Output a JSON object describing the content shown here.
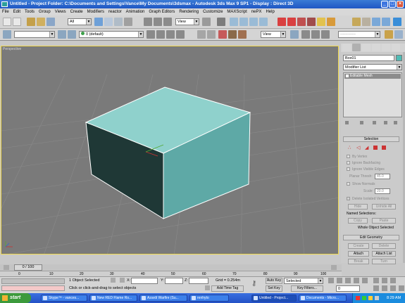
{
  "window": {
    "title": "Untitled    - Project Folder: C:\\Documents and Settings\\Vance\\My Documents\\3dsmax    - Autodesk 3ds Max 9 SP1    - Display : Direct 3D"
  },
  "menu": [
    "File",
    "Edit",
    "Tools",
    "Group",
    "Views",
    "Create",
    "Modifiers",
    "reactor",
    "Animation",
    "Graph Editors",
    "Rendering",
    "Customize",
    "MAXScript",
    "nePX",
    "Help"
  ],
  "toolbar": {
    "selection_filter": "All",
    "view_dropdown": "View",
    "layer_dropdown": "0 (default)",
    "view_dropdown2": "View"
  },
  "viewport": {
    "label": "Perspective",
    "box_colors": {
      "top": "#8fd1cc",
      "front": "#5ea9a6",
      "left": "#1f3836"
    }
  },
  "command_panel": {
    "object_name": "Box01",
    "modifier_list": "Modifier List",
    "stack_item": "Editable Mesh",
    "selection_rollout": "Selection",
    "by_vertex": "By Vertex",
    "ignore_backfacing": "Ignore Backfacing",
    "ignore_visible_edges": "Ignore Visible Edges",
    "planar_thresh_label": "Planar Thresh:",
    "planar_thresh_value": "45.0",
    "show_normals": "Show Normals",
    "scale_label": "Scale:",
    "scale_value": "20.0",
    "delete_isolated": "Delete Isolated Vertices",
    "hide": "Hide",
    "unhide_all": "Unhide All",
    "named_selections": "Named Selections:",
    "copy": "Copy",
    "paste": "Paste",
    "whole_object": "Whole Object Selected",
    "edit_geometry_rollout": "Edit Geometry",
    "create": "Create",
    "delete": "Delete",
    "attach": "Attach",
    "attach_list": "Attach List",
    "break": "Break",
    "turn": "Turn"
  },
  "timeline": {
    "frame_counter": "0 / 100",
    "ticks": [
      "0",
      "10",
      "20",
      "30",
      "40",
      "50",
      "60",
      "70",
      "80",
      "90",
      "100"
    ]
  },
  "status": {
    "objects_selected": "1 Object Selected",
    "prompt": "Click or click-and-drag to select objects",
    "x_label": "X:",
    "y_label": "Y:",
    "z_label": "Z:",
    "grid": "Grid = 0.254m",
    "add_time_tag": "Add Time Tag",
    "auto_key": "Auto Key",
    "set_key": "Set Key",
    "selected": "Selected",
    "key_filters": "Key Filters...",
    "frame": "0"
  },
  "taskbar": {
    "start": "start",
    "items": [
      "Skype™ - vances...",
      "New RED Flame Ro...",
      "Azardi Warfire (Su...",
      "renhyto",
      "Untitled  - Project...",
      "Documents - Micro..."
    ],
    "clock": "8:29 AM"
  }
}
